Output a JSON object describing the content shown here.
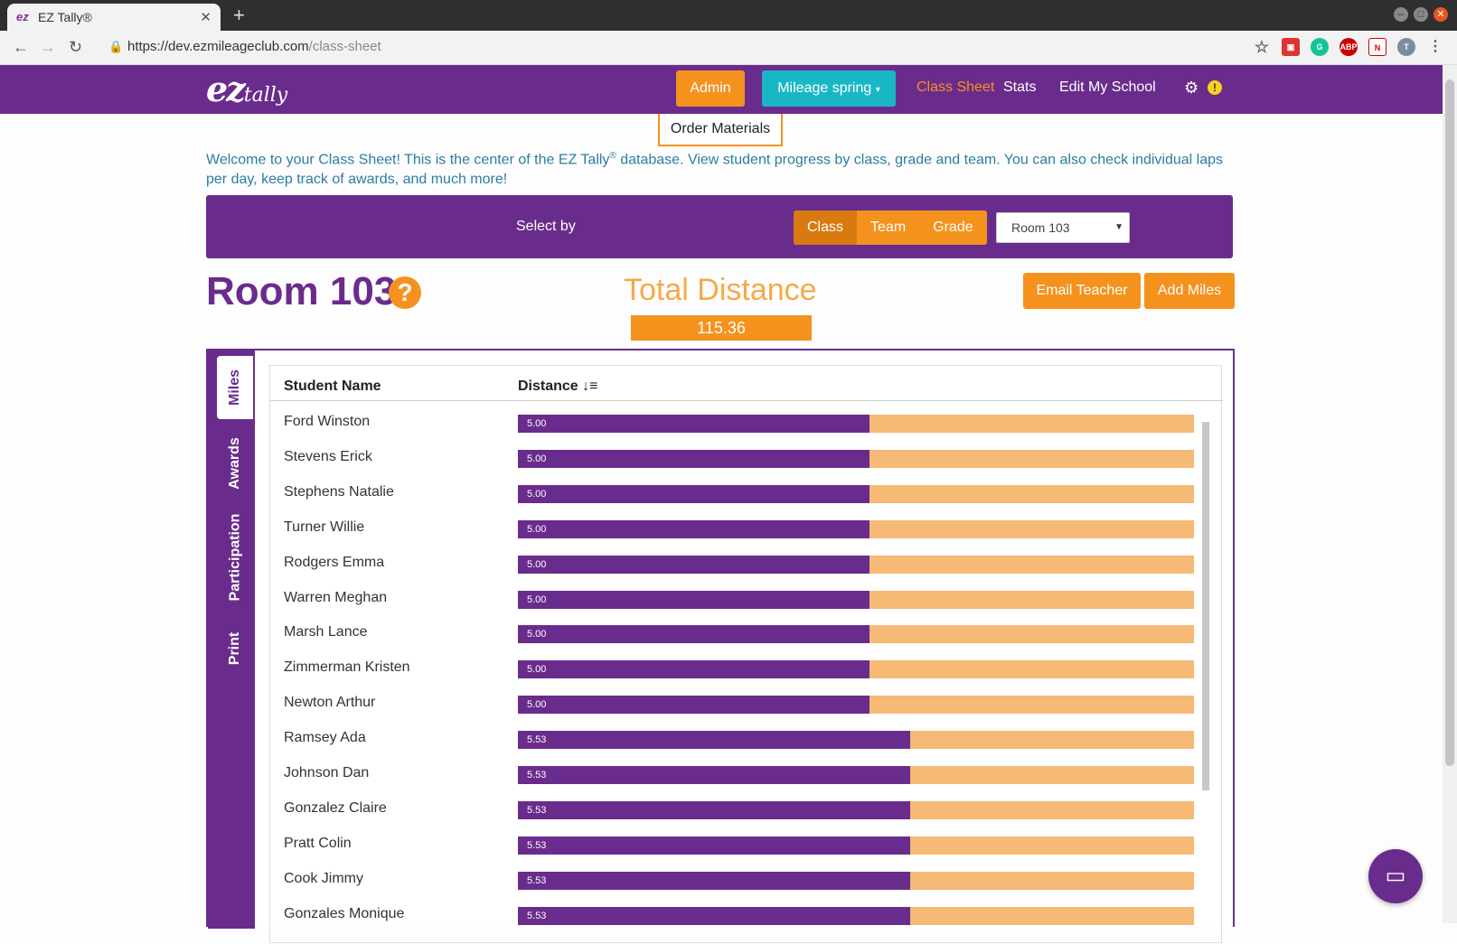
{
  "browser": {
    "tab_title": "EZ Tally®",
    "url_host": "https://dev.ezmileageclub.com",
    "url_path": "/class-sheet"
  },
  "header": {
    "logo_ez": "ez",
    "logo_tally": "tally",
    "admin_label": "Admin",
    "mileage_label": "Mileage spring",
    "nav": [
      "Class Sheet",
      "Stats",
      "Edit My School"
    ],
    "order_materials": "Order Materials"
  },
  "welcome": {
    "text1": "Welcome to your Class Sheet! This is the center of the EZ Tally",
    "reg": "®",
    "text2": " database. View student progress by class, grade and team. You can also check individual laps per day, keep track of awards, and much more!"
  },
  "selector": {
    "label": "Select by",
    "options": [
      "Class",
      "Team",
      "Grade"
    ],
    "selected": "Class",
    "room_value": "Room 103"
  },
  "summary": {
    "room_title": "Room 103",
    "total_label": "Total Distance",
    "total_value": "115.36",
    "email_teacher": "Email Teacher",
    "add_miles": "Add Miles"
  },
  "side_tabs": [
    "Miles",
    "Awards",
    "Participation",
    "Print"
  ],
  "table": {
    "col_name": "Student Name",
    "col_distance": "Distance",
    "rows": [
      {
        "name": "Ford Winston",
        "distance": "5.00",
        "fraction": 0.52
      },
      {
        "name": "Stevens Erick",
        "distance": "5.00",
        "fraction": 0.52
      },
      {
        "name": "Stephens Natalie",
        "distance": "5.00",
        "fraction": 0.52
      },
      {
        "name": "Turner Willie",
        "distance": "5.00",
        "fraction": 0.52
      },
      {
        "name": "Rodgers Emma",
        "distance": "5.00",
        "fraction": 0.52
      },
      {
        "name": "Warren Meghan",
        "distance": "5.00",
        "fraction": 0.52
      },
      {
        "name": "Marsh Lance",
        "distance": "5.00",
        "fraction": 0.52
      },
      {
        "name": "Zimmerman Kristen",
        "distance": "5.00",
        "fraction": 0.52
      },
      {
        "name": "Newton Arthur",
        "distance": "5.00",
        "fraction": 0.52
      },
      {
        "name": "Ramsey Ada",
        "distance": "5.53",
        "fraction": 0.58
      },
      {
        "name": "Johnson Dan",
        "distance": "5.53",
        "fraction": 0.58
      },
      {
        "name": "Gonzalez Claire",
        "distance": "5.53",
        "fraction": 0.58
      },
      {
        "name": "Pratt Colin",
        "distance": "5.53",
        "fraction": 0.58
      },
      {
        "name": "Cook Jimmy",
        "distance": "5.53",
        "fraction": 0.58
      },
      {
        "name": "Gonzales Monique",
        "distance": "5.53",
        "fraction": 0.58
      }
    ]
  },
  "colors": {
    "purple": "#6a2c8c",
    "orange": "#f5921e",
    "teal": "#19b7c6",
    "bar_remaining": "#f6b976"
  }
}
